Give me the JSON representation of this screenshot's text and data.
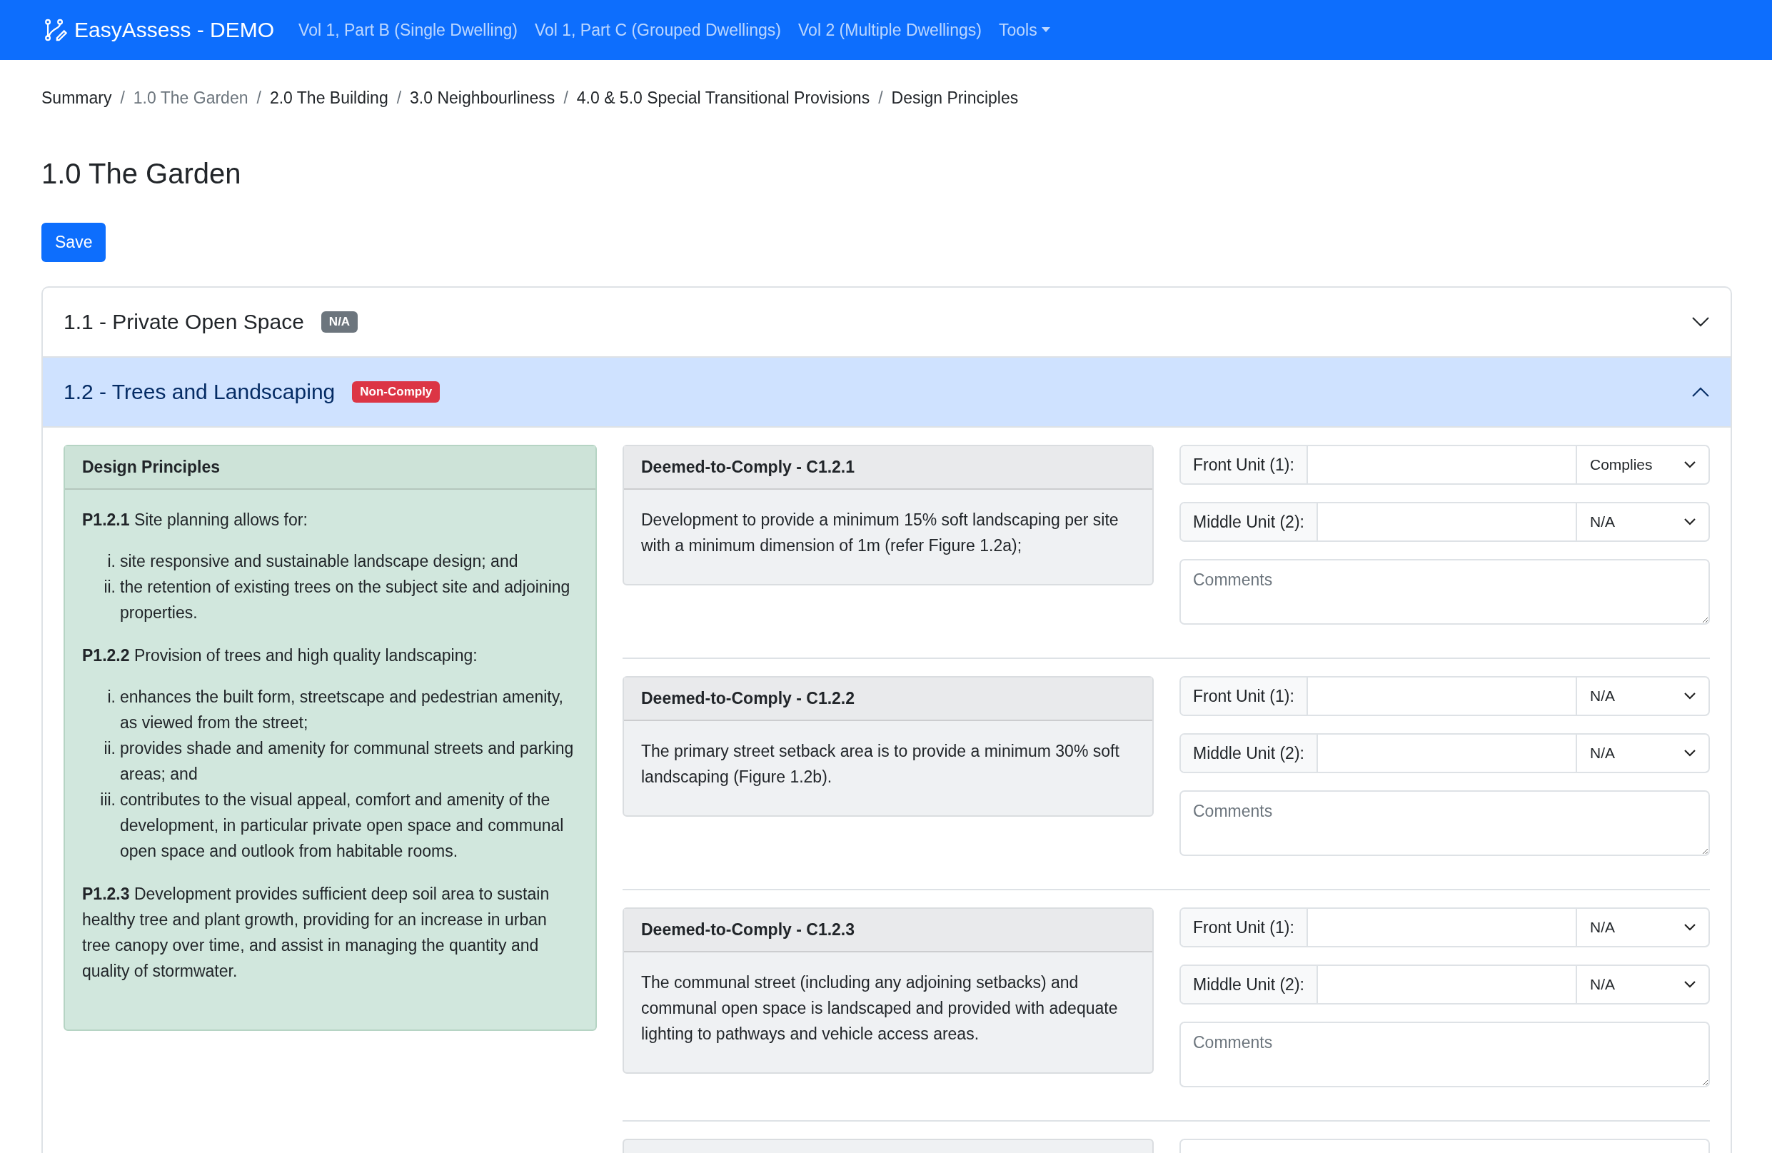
{
  "navbar": {
    "brand": "EasyAssess - DEMO",
    "links": [
      "Vol 1, Part B (Single Dwelling)",
      "Vol 1, Part C (Grouped Dwellings)",
      "Vol 2 (Multiple Dwellings)"
    ],
    "dropdown": "Tools"
  },
  "breadcrumb": [
    {
      "label": "Summary",
      "selected": false
    },
    {
      "separator": "/",
      "label": "1.0 The Garden",
      "selected": true
    },
    {
      "separator": "/",
      "label": "2.0 The Building",
      "selected": false
    },
    {
      "separator": "/",
      "label": "3.0 Neighbourliness",
      "selected": false
    },
    {
      "separator": "/",
      "label": "4.0 & 5.0 Special Transitional Provisions",
      "selected": false
    },
    {
      "separator": "/",
      "label": "Design Principles",
      "selected": false
    }
  ],
  "page_title": "1.0 The Garden",
  "save_button": "Save",
  "sections": [
    {
      "title": "1.1 - Private Open Space",
      "badge": "N/A",
      "color": "#6c757d",
      "expanded": false
    },
    {
      "title": "1.2 - Trees and Landscaping",
      "badge": "Non-Comply",
      "color": "#dc3545",
      "expanded": true,
      "principles": {
        "title": "Design Principles",
        "items": [
          {
            "text": "**P1.2.1** Site planning allows for:",
            "list": [
              {
                "marker": "i.",
                "text": "site responsive and sustainable landscape design; and"
              },
              {
                "marker": "ii.",
                "text": "the retention of existing trees on the subject site and adjoining properties."
              }
            ]
          },
          {
            "text": "**P1.2.2** Provision of trees and high quality landscaping:",
            "list": [
              {
                "marker": "i.",
                "text": "enhances the built form, streetscape and pedestrian amenity, as viewed from the street;"
              },
              {
                "marker": "ii.",
                "text": "provides shade and amenity for communal streets and parking areas; and"
              },
              {
                "marker": "iii.",
                "text": "contributes to the visual appeal, comfort and amenity of the development, in particular private open space and communal open space and outlook from habitable rooms."
              }
            ]
          },
          {
            "text": "**P1.2.3** Development provides sufficient deep soil area to sustain healthy tree and plant growth, providing for an increase in urban tree canopy over time, and assist in managing the quantity and quality of stormwater."
          }
        ]
      },
      "requirements": [
        {
          "title": "Deemed-to-Comply - C1.2.1",
          "text": "Development to provide a minimum 15% soft landscaping per site with a minimum dimension of 1m (refer Figure 1.2a);",
          "units": [
            {
              "label": "Front Unit (1):",
              "value": "Complies"
            },
            {
              "label": "Middle Unit (2):",
              "value": "N/A"
            }
          ],
          "comments_placeholder": "Comments"
        },
        {
          "title": "Deemed-to-Comply - C1.2.2",
          "text": "The primary street setback area is to provide a minimum 30% soft landscaping (Figure 1.2b).",
          "units": [
            {
              "label": "Front Unit (1):",
              "value": "N/A"
            },
            {
              "label": "Middle Unit (2):",
              "value": "N/A"
            }
          ],
          "comments_placeholder": "Comments"
        },
        {
          "title": "Deemed-to-Comply - C1.2.3",
          "text": "The communal street (including any adjoining setbacks) and communal open space is landscaped and provided with adequate lighting to pathways and vehicle access areas.",
          "units": [
            {
              "label": "Front Unit (1):",
              "value": "N/A"
            },
            {
              "label": "Middle Unit (2):",
              "value": "N/A"
            }
          ],
          "comments_placeholder": "Comments"
        }
      ]
    }
  ]
}
